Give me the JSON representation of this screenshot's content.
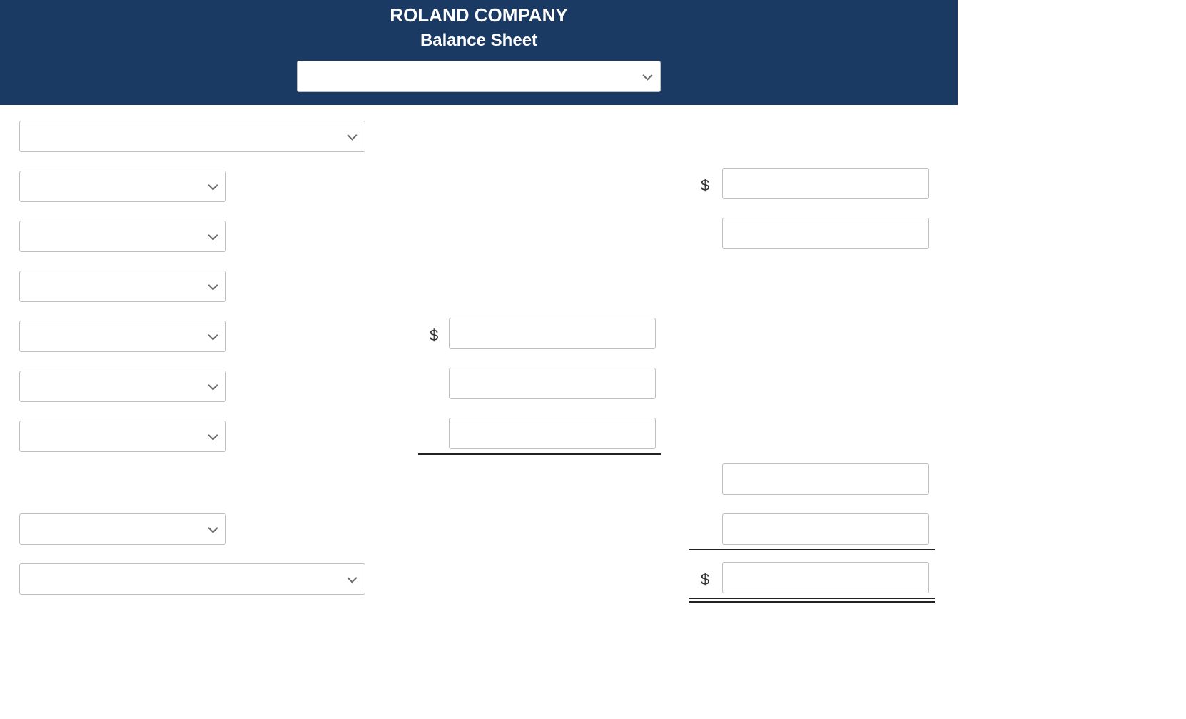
{
  "header": {
    "company": "ROLAND COMPANY",
    "title": "Balance Sheet",
    "date_select_value": ""
  },
  "left": {
    "section_select": "",
    "items": [
      "",
      "",
      "",
      "",
      "",
      ""
    ],
    "item7": "",
    "section_select_2": ""
  },
  "mid": {
    "dollar1": "$",
    "inputs": [
      "",
      "",
      ""
    ]
  },
  "right": {
    "dollar1": "$",
    "inputs_top": [
      "",
      ""
    ],
    "inputs_mid": [
      "",
      ""
    ],
    "dollar2": "$",
    "total_input": ""
  }
}
